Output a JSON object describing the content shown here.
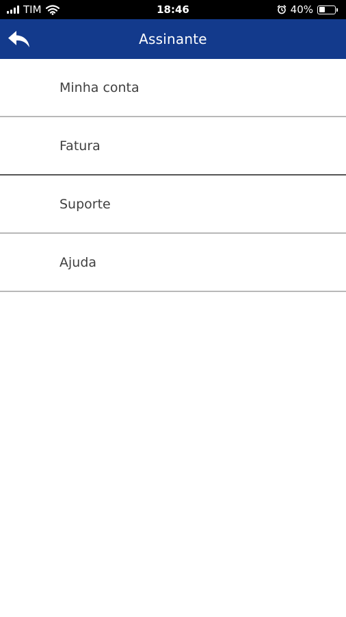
{
  "status_bar": {
    "carrier": "TIM",
    "time": "18:46",
    "battery_percent": "40%",
    "battery_level": 0.4,
    "icons": [
      "signal-icon",
      "wifi-icon",
      "alarm-icon",
      "battery-icon"
    ]
  },
  "header": {
    "title": "Assinante",
    "back_icon": "back-arrow-icon",
    "background_color": "#133a8c"
  },
  "menu": {
    "items": [
      {
        "label": "Minha conta"
      },
      {
        "label": "Fatura"
      },
      {
        "label": "Suporte"
      },
      {
        "label": "Ajuda"
      }
    ]
  }
}
